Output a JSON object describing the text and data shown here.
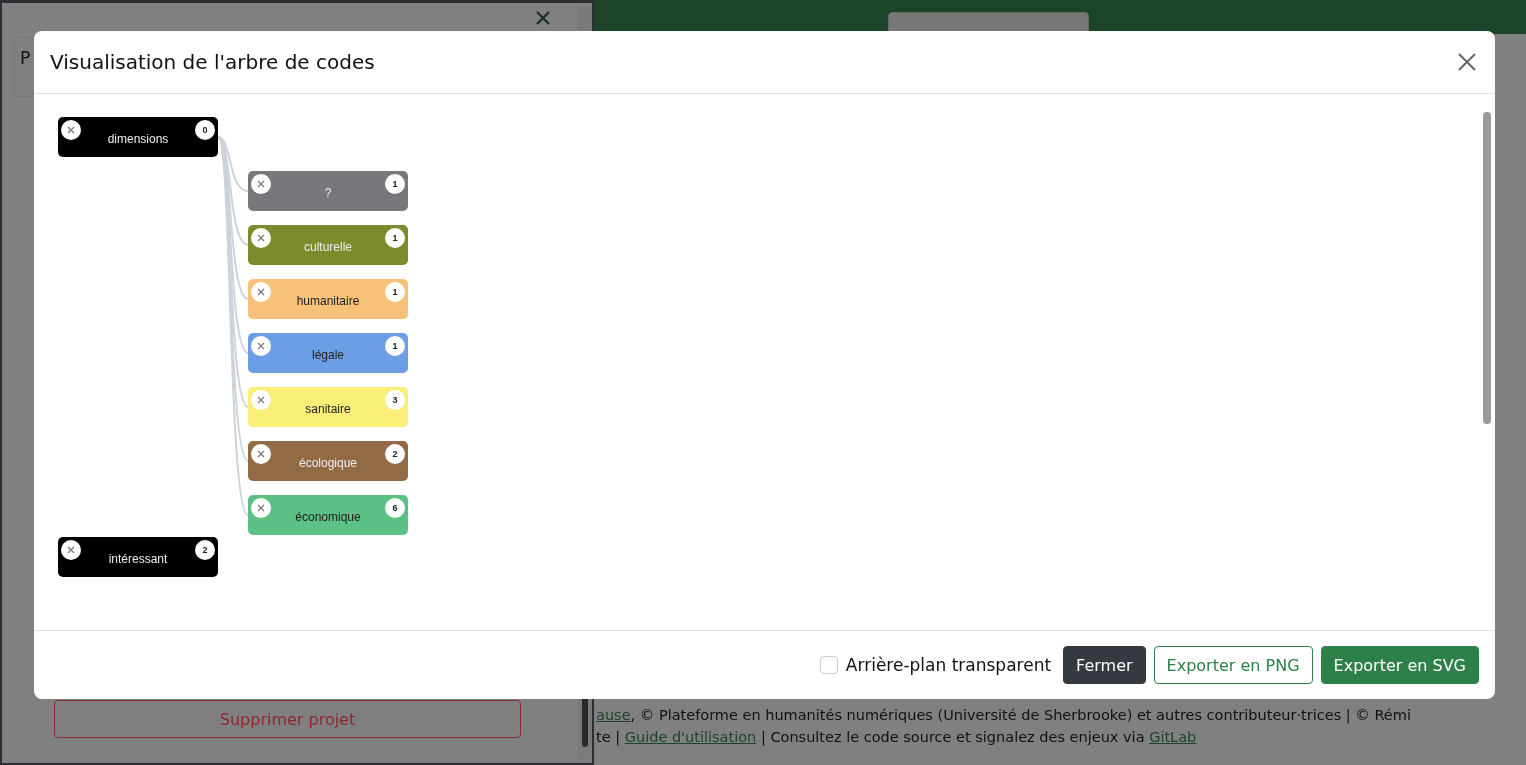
{
  "side_panel": {
    "tab": "P",
    "delete_button": "Supprimer projet"
  },
  "footer": {
    "line_1": [
      {
        "text": "ause",
        "kind": "link"
      },
      {
        "text": ", © Plateforme en humanités numériques (Université de Sherbrooke) et autres contributeur·trices | © Rémi",
        "kind": "text"
      }
    ],
    "line_2": [
      {
        "text": "te | ",
        "kind": "text"
      },
      {
        "text": "Guide d'utilisation",
        "kind": "link"
      },
      {
        "text": " | Consultez le code source et signalez des enjeux via ",
        "kind": "text"
      },
      {
        "text": "GitLab",
        "kind": "link"
      }
    ]
  },
  "modal": {
    "title": "Visualisation de l'arbre de codes",
    "tree": [
      {
        "label": "dimensions",
        "count": "0",
        "color": "#000000",
        "children": [
          {
            "label": "?",
            "count": "1",
            "color": "#78777c"
          },
          {
            "label": "culturelle",
            "count": "1",
            "color": "#7d8b2c"
          },
          {
            "label": "humanitaire",
            "count": "1",
            "color": "#f7c17a"
          },
          {
            "label": "légale",
            "count": "1",
            "color": "#6c9ee6"
          },
          {
            "label": "sanitaire",
            "count": "3",
            "color": "#f8ee78"
          },
          {
            "label": "écologique",
            "count": "2",
            "color": "#926a46"
          },
          {
            "label": "économique",
            "count": "6",
            "color": "#5bc184"
          }
        ]
      },
      {
        "label": "intéressant",
        "count": "2",
        "color": "#000000"
      }
    ],
    "transparent_background": {
      "label": "Arrière-plan transparent",
      "checked": false
    },
    "buttons": [
      {
        "label": "Fermer",
        "kind": "dark"
      },
      {
        "label": "Exporter en PNG",
        "kind": "outline"
      },
      {
        "label": "Exporter en SVG",
        "kind": "primary"
      }
    ]
  }
}
